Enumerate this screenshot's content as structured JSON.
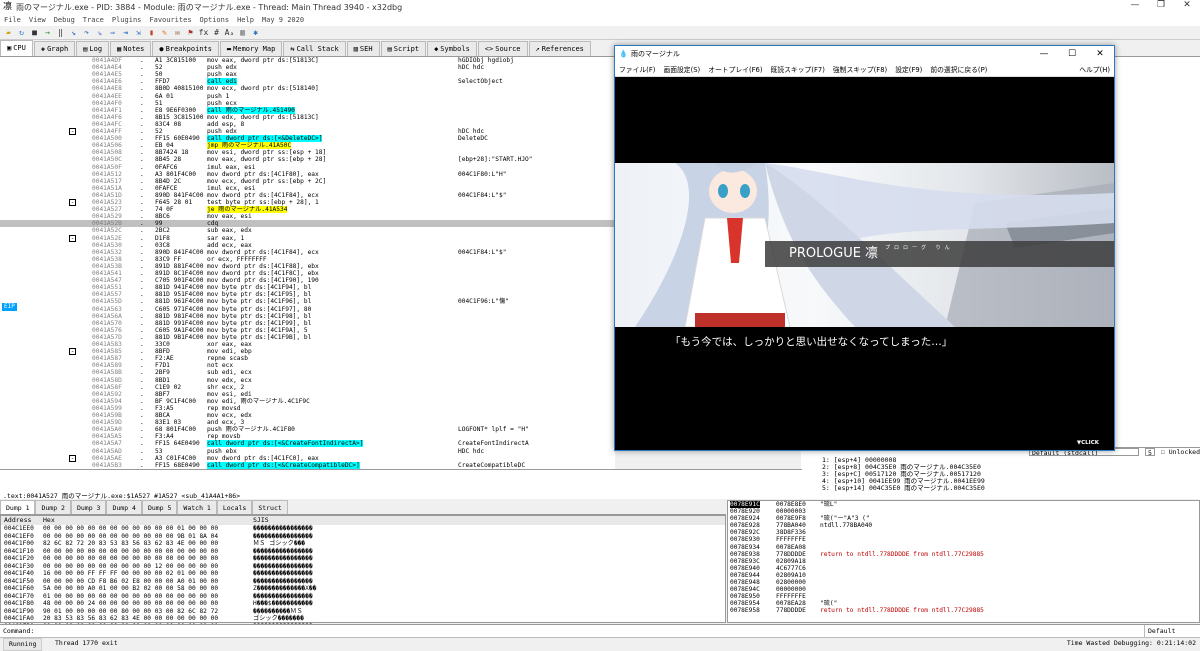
{
  "window": {
    "title": "雨のマージナル.exe - PID: 3884 - Module: 雨のマージナル.exe - Thread: Main Thread 3940 - x32dbg",
    "controls": [
      "—",
      "❐",
      "✕"
    ]
  },
  "menu": [
    "File",
    "View",
    "Debug",
    "Trace",
    "Plugins",
    "Favourites",
    "Options",
    "Help",
    "May 9 2020"
  ],
  "tabs": [
    {
      "label": "CPU",
      "icon": "cpu-icon",
      "glyph": "▣",
      "active": true
    },
    {
      "label": "Graph",
      "icon": "graph-icon",
      "glyph": "◈"
    },
    {
      "label": "Log",
      "icon": "log-icon",
      "glyph": "▤"
    },
    {
      "label": "Notes",
      "icon": "notes-icon",
      "glyph": "▦"
    },
    {
      "label": "Breakpoints",
      "icon": "breakpoint-icon",
      "glyph": "●"
    },
    {
      "label": "Memory Map",
      "icon": "memory-map-icon",
      "glyph": "▬"
    },
    {
      "label": "Call Stack",
      "icon": "call-stack-icon",
      "glyph": "⇆"
    },
    {
      "label": "SEH",
      "icon": "seh-icon",
      "glyph": "▧"
    },
    {
      "label": "Script",
      "icon": "script-icon",
      "glyph": "▤"
    },
    {
      "label": "Symbols",
      "icon": "symbols-icon",
      "glyph": "◆"
    },
    {
      "label": "Source",
      "icon": "source-icon",
      "glyph": "<>"
    },
    {
      "label": "References",
      "icon": "references-icon",
      "glyph": "↗"
    }
  ],
  "disasm": [
    {
      "addr": "0041A4DF",
      "bytes": "A1 3C815100",
      "dis": "mov eax, dword ptr ds:[51813C]",
      "cmt": "hGDIObj hgdiobj"
    },
    {
      "addr": "0041A4E4",
      "bytes": "52",
      "dis": "push edx",
      "cmt": "hDC hdc"
    },
    {
      "addr": "0041A4E5",
      "bytes": "50",
      "dis": "push eax"
    },
    {
      "addr": "0041A4E6",
      "bytes": "FFD7",
      "dis": "call edi",
      "cls": "cl",
      "cmt": "SelectObject"
    },
    {
      "addr": "0041A4E8",
      "bytes": "8B0D 40815100",
      "dis": "mov ecx, dword ptr ds:[518140]"
    },
    {
      "addr": "0041A4EE",
      "bytes": "6A 01",
      "dis": "push 1"
    },
    {
      "addr": "0041A4F0",
      "bytes": "51",
      "dis": "push ecx"
    },
    {
      "addr": "0041A4F1",
      "bytes": "E8 9E6F0300",
      "dis": "call 雨のマージナル.451490",
      "cls": "cl"
    },
    {
      "addr": "0041A4F6",
      "bytes": "8B15 3C815100",
      "dis": "mov edx, dword ptr ds:[51813C]"
    },
    {
      "addr": "0041A4FC",
      "bytes": "83C4 08",
      "dis": "add esp, 8"
    },
    {
      "addr": "0041A4FF",
      "bytes": "52",
      "dis": "push edx",
      "cmt": "hDC hdc"
    },
    {
      "addr": "0041A500",
      "bytes": "FF15 60E0490",
      "dis": "call dword ptr ds:[<&DeleteDC>]",
      "cls": "cl",
      "cmt": "DeleteDC"
    },
    {
      "addr": "0041A506",
      "bytes": "EB 04",
      "dis": "jmp 雨のマージナル.41A50C",
      "cls": "jp"
    },
    {
      "addr": "0041A508",
      "bytes": "8B7424 18",
      "dis": "mov esi, dword ptr ss:[esp + 18]"
    },
    {
      "addr": "0041A50C",
      "bytes": "8B45 28",
      "dis": "mov eax, dword ptr ss:[ebp + 28]",
      "cmt": "[ebp+28]:\"START.HJO\""
    },
    {
      "addr": "0041A50F",
      "bytes": "0FAFC6",
      "dis": "imul eax, esi"
    },
    {
      "addr": "0041A512",
      "bytes": "A3 801F4C00",
      "dis": "mov dword ptr ds:[4C1F80], eax",
      "cmt": "004C1F80:L\"H\""
    },
    {
      "addr": "0041A517",
      "bytes": "8B4D 2C",
      "dis": "mov ecx, dword ptr ss:[ebp + 2C]"
    },
    {
      "addr": "0041A51A",
      "bytes": "0FAFCE",
      "dis": "imul ecx, esi"
    },
    {
      "addr": "0041A51D",
      "bytes": "890D 841F4C00",
      "dis": "mov dword ptr ds:[4C1F84], ecx",
      "cmt": "004C1F84:L\"$\""
    },
    {
      "addr": "0041A523",
      "bytes": "F645 28 01",
      "dis": "test byte ptr ss:[ebp + 28], 1"
    },
    {
      "addr": "0041A527",
      "bytes": "74 0F",
      "dis": "je 雨のマージナル.41A534",
      "cls": "jp"
    },
    {
      "addr": "0041A529",
      "bytes": "8BC6",
      "dis": "mov eax, esi"
    },
    {
      "addr": "0041A52B",
      "bytes": "99",
      "dis": "cdq",
      "cur": true
    },
    {
      "addr": "0041A52C",
      "bytes": "2BC2",
      "dis": "sub eax, edx"
    },
    {
      "addr": "0041A52E",
      "bytes": "D1F8",
      "dis": "sar eax, 1"
    },
    {
      "addr": "0041A530",
      "bytes": "03C8",
      "dis": "add ecx, eax"
    },
    {
      "addr": "0041A532",
      "bytes": "890D 841F4C00",
      "dis": "mov dword ptr ds:[4C1F84], ecx",
      "cmt": "004C1F84:L\"$\""
    },
    {
      "addr": "0041A538",
      "bytes": "83C9 FF",
      "dis": "or ecx, FFFFFFFF"
    },
    {
      "addr": "0041A53B",
      "bytes": "891D 881F4C00",
      "dis": "mov dword ptr ds:[4C1F88], ebx"
    },
    {
      "addr": "0041A541",
      "bytes": "891D 8C1F4C00",
      "dis": "mov dword ptr ds:[4C1F8C], ebx"
    },
    {
      "addr": "0041A547",
      "bytes": "C705 901F4C00",
      "dis": "mov dword ptr ds:[4C1F90], 190"
    },
    {
      "addr": "0041A551",
      "bytes": "881D 941F4C00",
      "dis": "mov byte ptr ds:[4C1F94], bl"
    },
    {
      "addr": "0041A557",
      "bytes": "881D 951F4C00",
      "dis": "mov byte ptr ds:[4C1F95], bl"
    },
    {
      "addr": "0041A55D",
      "bytes": "881D 961F4C00",
      "dis": "mov byte ptr ds:[4C1F96], bl",
      "cmt": "004C1F96:L\"慯\""
    },
    {
      "addr": "0041A563",
      "bytes": "C605 971F4C00",
      "dis": "mov byte ptr ds:[4C1F97], 80"
    },
    {
      "addr": "0041A56A",
      "bytes": "881D 981F4C00",
      "dis": "mov byte ptr ds:[4C1F98], bl"
    },
    {
      "addr": "0041A570",
      "bytes": "881D 991F4C00",
      "dis": "mov byte ptr ds:[4C1F99], bl"
    },
    {
      "addr": "0041A576",
      "bytes": "C605 9A1F4C00",
      "dis": "mov byte ptr ds:[4C1F9A], 5"
    },
    {
      "addr": "0041A57D",
      "bytes": "881D 9B1F4C00",
      "dis": "mov byte ptr ds:[4C1F9B], bl"
    },
    {
      "addr": "0041A583",
      "bytes": "33C0",
      "dis": "xor eax, eax"
    },
    {
      "addr": "0041A585",
      "bytes": "8BFD",
      "dis": "mov edi, ebp"
    },
    {
      "addr": "0041A587",
      "bytes": "F2:AE",
      "dis": "repne scasb"
    },
    {
      "addr": "0041A589",
      "bytes": "F7D1",
      "dis": "not ecx"
    },
    {
      "addr": "0041A58B",
      "bytes": "2BF9",
      "dis": "sub edi, ecx"
    },
    {
      "addr": "0041A58D",
      "bytes": "8BD1",
      "dis": "mov edx, ecx"
    },
    {
      "addr": "0041A58F",
      "bytes": "C1E9 02",
      "dis": "shr ecx, 2"
    },
    {
      "addr": "0041A592",
      "bytes": "8BF7",
      "dis": "mov esi, edi"
    },
    {
      "addr": "0041A594",
      "bytes": "BF 9C1F4C00",
      "dis": "mov edi, 雨のマージナル.4C1F9C"
    },
    {
      "addr": "0041A599",
      "bytes": "F3:A5",
      "dis": "rep movsd"
    },
    {
      "addr": "0041A59B",
      "bytes": "8BCA",
      "dis": "mov ecx, edx"
    },
    {
      "addr": "0041A59D",
      "bytes": "83E1 03",
      "dis": "and ecx, 3"
    },
    {
      "addr": "0041A5A0",
      "bytes": "68 801F4C00",
      "dis": "push 雨のマージナル.4C1F80",
      "cmt": "LOGFONT* lplf = \"H\""
    },
    {
      "addr": "0041A5A5",
      "bytes": "F3:A4",
      "dis": "rep movsb"
    },
    {
      "addr": "0041A5A7",
      "bytes": "FF15 64E0490",
      "dis": "call dword ptr ds:[<&CreateFontIndirectA>]",
      "cls": "cl",
      "cmt": "CreateFontIndirectA"
    },
    {
      "addr": "0041A5AD",
      "bytes": "53",
      "dis": "push ebx",
      "cmt": "HDC hdc"
    },
    {
      "addr": "0041A5AE",
      "bytes": "A3 C01F4C00",
      "dis": "mov dword ptr ds:[4C1FC0], eax"
    },
    {
      "addr": "0041A5B3",
      "bytes": "FF15 68E0490",
      "dis": "call dword ptr ds:[<&CreateCompatibleDC>]",
      "cls": "cl",
      "cmt": "CreateCompatibleDC"
    }
  ],
  "eip_label": "EIP",
  "info_line": ".text:0041A527 雨のマージナル.exe:$1A527 #1A527 <sub_41A4A1+86>",
  "stack_args": {
    "default_label": "Default (stdcall)",
    "count": "5",
    "unlocked_label": "Unlocked",
    "lines": [
      "1: [esp+4] 00000008",
      "2: [esp+8] 004C35E0 雨のマージナル.004C35E0",
      "3: [esp+C] 00517120 雨のマージナル.00517120",
      "4: [esp+10] 0041EE99 雨のマージナル.0041EE99",
      "5: [esp+14] 004C35E0 雨のマージナル.004C35E0"
    ]
  },
  "dump_tabs": [
    "Dump 1",
    "Dump 2",
    "Dump 3",
    "Dump 4",
    "Dump 5",
    "Watch 1",
    "Locals",
    "Struct"
  ],
  "dump_headers": {
    "addr": "Address",
    "hex": "Hex",
    "ascii": "SJIS"
  },
  "dump_rows": [
    {
      "addr": "004C1EE0",
      "hex": "00 00 00 00 00 00 00 00 00 00 00 00 01 00 00 00",
      "asc": "����������������"
    },
    {
      "addr": "004C1EF0",
      "hex": "00 00 00 00 00 00 00 00 00 00 00 00 9B 01 8A 04",
      "asc": "����������������"
    },
    {
      "addr": "004C1F00",
      "hex": "82 6C 82 72 20 83 53 83 56 83 62 83 4E 00 00 00",
      "asc": "ＭＳ ゴシック���"
    },
    {
      "addr": "004C1F10",
      "hex": "00 00 00 00 00 00 00 00 00 00 00 00 00 00 00 00",
      "asc": "����������������"
    },
    {
      "addr": "004C1F20",
      "hex": "00 00 00 00 00 00 00 00 00 00 00 00 00 00 00 00",
      "asc": "����������������"
    },
    {
      "addr": "004C1F30",
      "hex": "00 00 00 00 00 00 00 00 00 00 12 00 00 00 00 00",
      "asc": "����������������"
    },
    {
      "addr": "004C1F40",
      "hex": "16 00 00 00 FF FF FF 00 00 00 00 02 01 00 00 00",
      "asc": "����������������"
    },
    {
      "addr": "004C1F50",
      "hex": "00 00 00 00 CD F8 B6 02 E8 00 00 00 A0 01 00 00",
      "asc": "����������������"
    },
    {
      "addr": "004C1F60",
      "hex": "5A 00 00 00 A0 01 00 00 B2 02 00 00 58 00 00 00",
      "asc": "Z�������������X��"
    },
    {
      "addr": "004C1F70",
      "hex": "01 00 00 00 00 00 00 00 00 00 00 00 00 00 00 00",
      "asc": "����������������"
    },
    {
      "addr": "004C1F80",
      "hex": "48 00 00 00 24 00 00 00 00 00 00 00 00 00 00 00",
      "asc": "H���$�����������"
    },
    {
      "addr": "004C1F90",
      "hex": "90 01 00 00 00 00 00 80 00 00 03 00 82 6C 82 72",
      "asc": "����������ＭＳ"
    },
    {
      "addr": "004C1FA0",
      "hex": "20 83 53 83 56 83 62 83 4E 00 00 00 00 00 00 00",
      "asc": " ゴシック�������"
    },
    {
      "addr": "004C1FB0",
      "hex": "00 00 00 00 00 00 00 00 00 00 00 00 00 00 00 00",
      "asc": "����������������"
    },
    {
      "addr": "004C1FC0",
      "hex": "B0 0E 0A 0B 00 00 00 00 00 00 00 00 00 00 00 00",
      "asc": "����������������"
    }
  ],
  "stack_rows": [
    {
      "addr": "0078E91C",
      "val": "0078E8E0",
      "cmt": "\"琉L\"",
      "cur": true
    },
    {
      "addr": "0078E920",
      "val": "00000003",
      "cmt": ""
    },
    {
      "addr": "0078E924",
      "val": "0078E9F8",
      "cmt": "\"琉(\"ー\"A\"3 (\""
    },
    {
      "addr": "0078E928",
      "val": "778BA040",
      "cmt": "ntdll.778BA040"
    },
    {
      "addr": "0078E92C",
      "val": "38D8F336",
      "cmt": ""
    },
    {
      "addr": "0078E930",
      "val": "FFFFFFFE",
      "cmt": ""
    },
    {
      "addr": "0078E934",
      "val": "0078EA08",
      "cmt": ""
    },
    {
      "addr": "0078E938",
      "val": "778DDDDE",
      "cmt": "return to ntdll.778DDDDE from ntdll.77C29885"
    },
    {
      "addr": "0078E93C",
      "val": "02809A18",
      "cmt": ""
    },
    {
      "addr": "0078E940",
      "val": "4C6777C6",
      "cmt": ""
    },
    {
      "addr": "0078E944",
      "val": "02809A10",
      "cmt": ""
    },
    {
      "addr": "0078E948",
      "val": "02800000",
      "cmt": ""
    },
    {
      "addr": "0078E94C",
      "val": "00000000",
      "cmt": ""
    },
    {
      "addr": "0078E950",
      "val": "FFFFFFFE",
      "cmt": ""
    },
    {
      "addr": "0078E954",
      "val": "0078EA28",
      "cmt": "\"琉(\""
    },
    {
      "addr": "0078E958",
      "val": "778DDDDE",
      "cmt": "return to ntdll.778DDDDE from ntdll.77C29885"
    }
  ],
  "command_label": "Command:",
  "command_mode": "Default",
  "status": {
    "state": "Running",
    "message": "Thread 1770 exit",
    "time": "Time Wasted Debugging: 0:21:14:02"
  },
  "game": {
    "title": "雨のマージナル",
    "menu": [
      "ファイル(F)",
      "画面設定(S)",
      "オートプレイ(F6)",
      "既読スキップ(F7)",
      "強制スキップ(F8)",
      "設定(F9)",
      "前の選択に戻る(P)",
      "ヘルプ(H)"
    ],
    "prologue": "PROLOGUE 凛",
    "prologue_ruby": "プロローグ りん",
    "dialogue": "「もう今では、しっかりと思い出せなくなってしまった…」",
    "click": "▼CLICK"
  }
}
